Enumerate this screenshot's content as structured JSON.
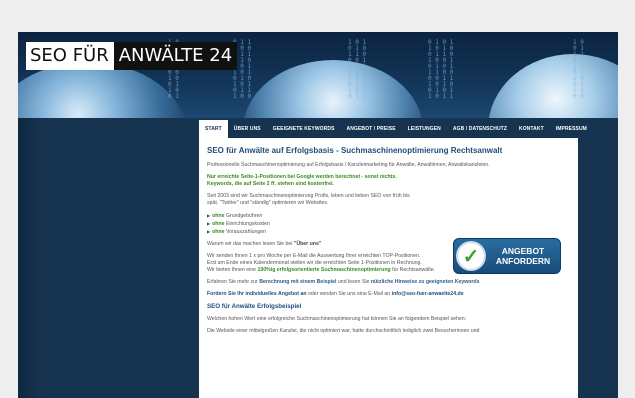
{
  "logo": {
    "part1": "SEO FÜR",
    "part2": "ANWÄLTE 24"
  },
  "nav": {
    "items": [
      {
        "label": "START",
        "active": true
      },
      {
        "label": "ÜBER UNS"
      },
      {
        "label": "GEEIGNETE KEYWORDS"
      },
      {
        "label": "ANGEBOT / PREISE"
      },
      {
        "label": "LEISTUNGEN"
      },
      {
        "label": "AGB / DATENSCHUTZ"
      },
      {
        "label": "KONTAKT"
      },
      {
        "label": "IMPRESSUM"
      }
    ]
  },
  "main": {
    "title": "SEO für Anwälte auf Erfolgsbasis - Suchmaschinenoptimierung Rechtsanwalt",
    "intro": "Professionelle Suchmaschinenoptimierung auf Erfolgsbasis / Kanzleimarketing für Anwälte, Anwältinnen, Anwaltskanzleien.",
    "green1": "Nur erreichte Seite-1-Positionen bei Google werden berechnet - sonst nichts.",
    "green2": "Keywords, die auf Seite 2 ff. stehen sind kostenfrei.",
    "since": "Seit 2003 sind wir Suchmaschinenoptimierung Profis, leben und lieben SEO von früh bis spät. \"Twitter\" und \"ständig\" optimieren wir Websites.",
    "list": [
      {
        "strong": "ohne",
        "text": "Grundgebühren"
      },
      {
        "strong": "ohne",
        "text": "Einrichtungskosten"
      },
      {
        "strong": "ohne",
        "text": "Vorauszahlungen"
      }
    ],
    "why_pre": "Warum wir das machen lesen Sie bei",
    "why_link": "\"Über uns\"",
    "p1": "Wir senden Ihnen 1 x pro Woche per E-Mail die Auswertung Ihrer erreichten TOP-Positionen.",
    "p2": "Erst am Ende eines Kalendermonat stellen wir die erreichten Seite 1-Positionen in Rechnung.",
    "p3_pre": "Wir bieten Ihnen eine",
    "p3_strong": "100%ig erfolgsorientierte Suchmaschinenoptimierung",
    "p3_post": "für Rechtsanwälte.",
    "p4_pre": "Erfahren Sie mehr zur",
    "p4_link1": "Berechnung mit einem Beispiel",
    "p4_mid": "und lesen Sie",
    "p4_link2": "nützliche Hinweise zu geeigneten Keywords",
    "p5_link": "Fordern Sie Ihr individuelles Angebot an",
    "p5_mid": "oder senden Sie uns eine E-Mail an",
    "p5_email": "info@seo-fuer-anwaelte24.de",
    "h2": "SEO für Anwälte Erfolgsbeispiel",
    "p6": "Welchen hohen Wert eine erfolgreiche Suchmaschinenoptimierung hat können Sie an folgendem Beispiel sehen:",
    "p7": "Die Website einer mittelgroßen Kanzlei, die nicht optimiert war, hatte durchschnittlich lediglich zwei Besucherinnen und"
  },
  "cta": {
    "line1": "ANGEBOT",
    "line2": "ANFORDERN",
    "icon": "checkmark-icon"
  },
  "colors": {
    "nav_bg": "#16334f",
    "title_blue": "#1f4e79",
    "green": "#3a8a1e",
    "page_bg": "#eeeeee"
  }
}
